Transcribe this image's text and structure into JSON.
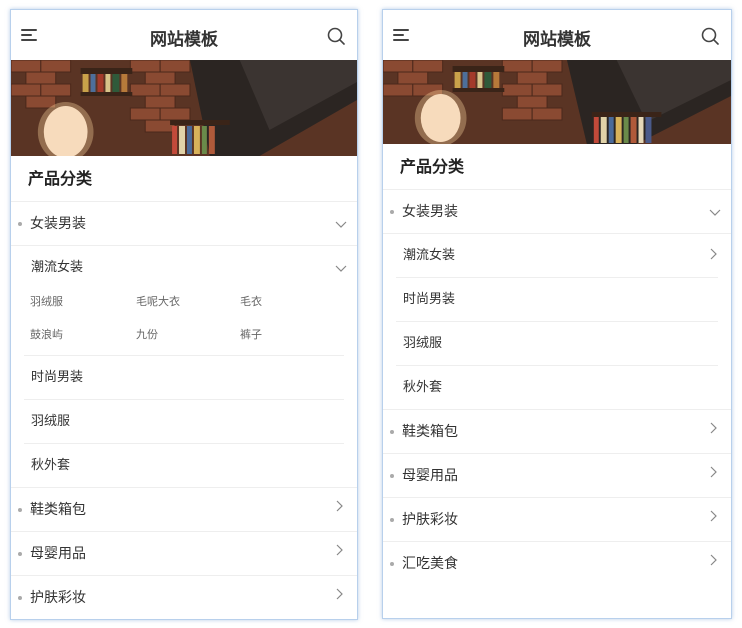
{
  "left": {
    "header": {
      "title": "网站模板",
      "menu_icon": "menu-icon",
      "search_icon": "search-icon"
    },
    "section_title": "产品分类",
    "expanded_top": "女装男装",
    "expanded_sub": "潮流女装",
    "grid": [
      "羽绒服",
      "毛呢大衣",
      "毛衣",
      "鼓浪屿",
      "九份",
      "裤子"
    ],
    "sub_items": [
      "时尚男装",
      "羽绒服",
      "秋外套"
    ],
    "collapsed_items": [
      "鞋类箱包",
      "母婴用品",
      "护肤彩妆"
    ]
  },
  "right": {
    "header": {
      "title": "网站模板",
      "menu_icon": "menu-icon",
      "search_icon": "search-icon"
    },
    "section_title": "产品分类",
    "expanded_top": "女装男装",
    "sub_items": [
      "潮流女装",
      "时尚男装",
      "羽绒服",
      "秋外套"
    ],
    "collapsed_items": [
      "鞋类箱包",
      "母婴用品",
      "护肤彩妆",
      "汇吃美食"
    ]
  },
  "colors": {
    "border": "#b8d0ec",
    "divider": "#eeeeee",
    "dot": "#aaaaaa",
    "text": "#333333"
  }
}
